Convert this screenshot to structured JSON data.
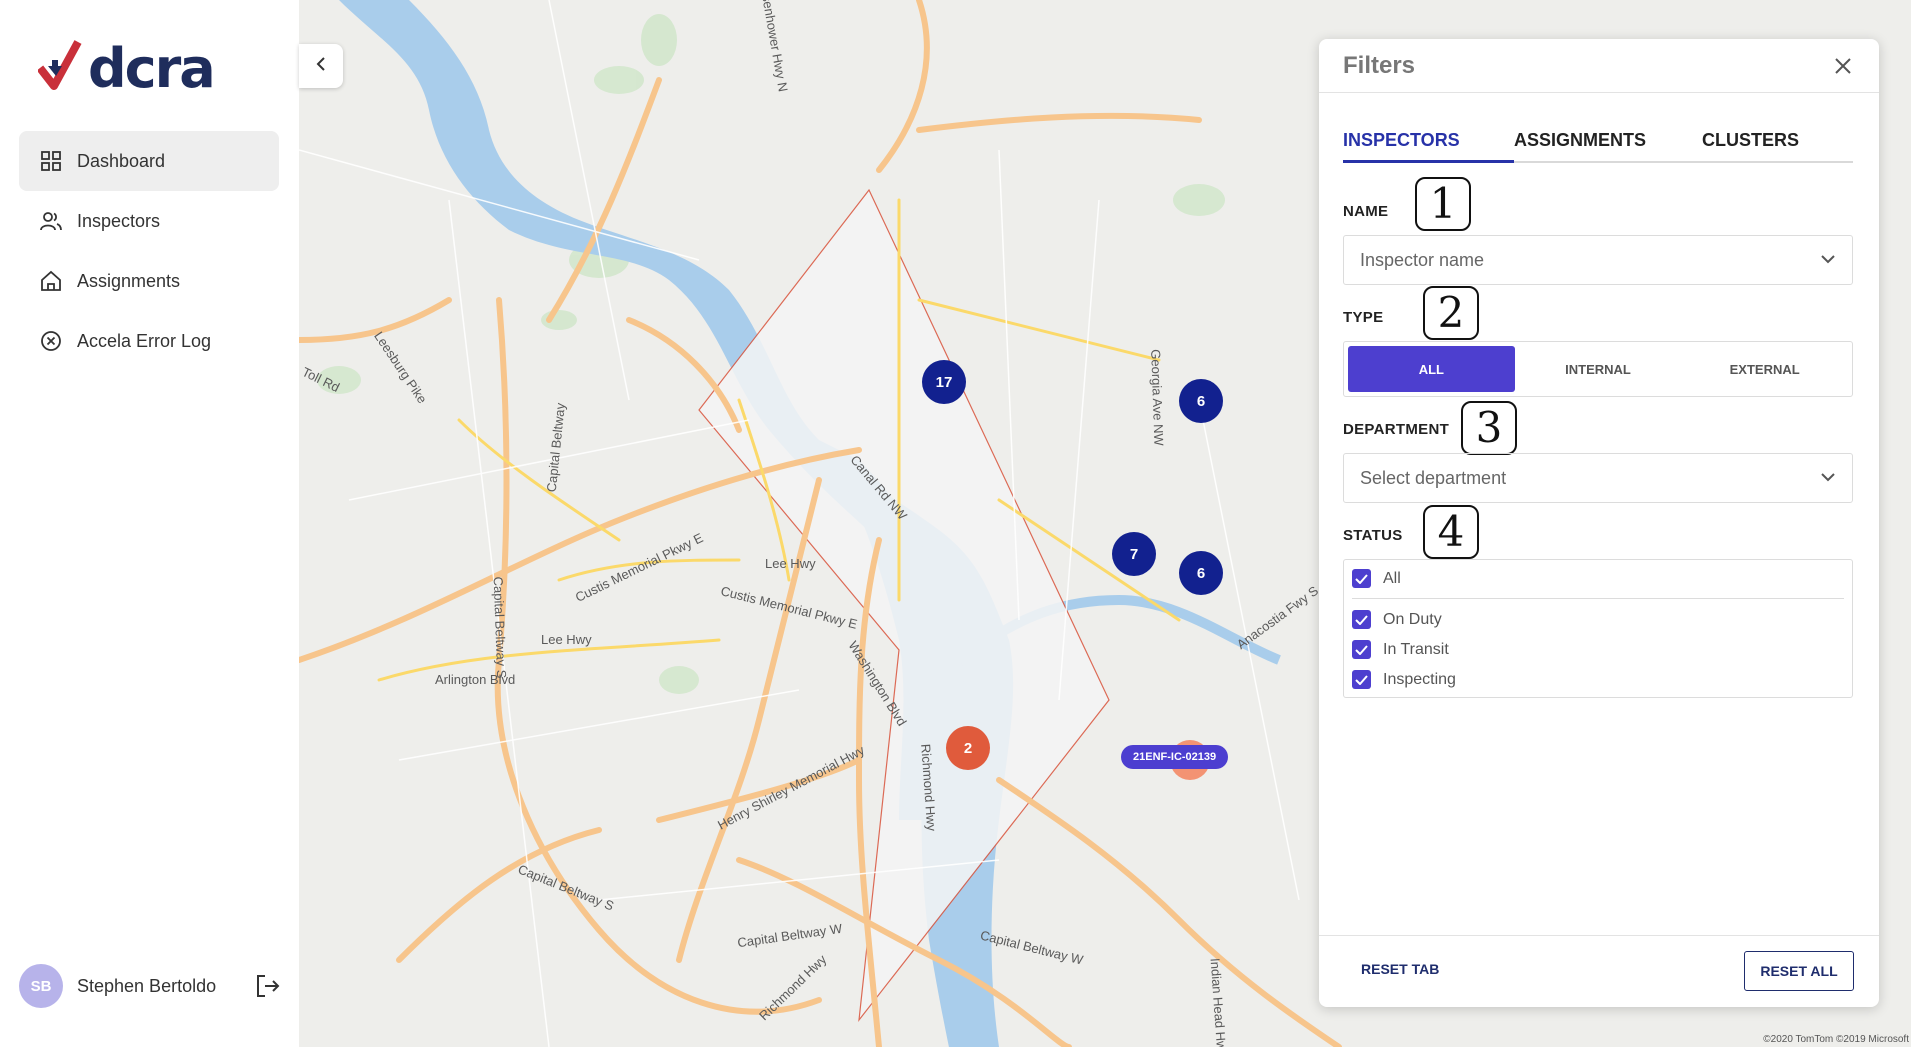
{
  "app": {
    "logo_text": "dcra"
  },
  "sidebar": {
    "items": [
      {
        "label": "Dashboard",
        "icon": "grid-icon",
        "active": true
      },
      {
        "label": "Inspectors",
        "icon": "users-icon",
        "active": false
      },
      {
        "label": "Assignments",
        "icon": "home-icon",
        "active": false
      },
      {
        "label": "Accela Error Log",
        "icon": "x-circle-icon",
        "active": false
      }
    ],
    "user": {
      "initials": "SB",
      "name": "Stephen Bertoldo"
    }
  },
  "map": {
    "clusters": [
      {
        "label": "17",
        "color": "#12218f"
      },
      {
        "label": "6",
        "color": "#12218f"
      },
      {
        "label": "7",
        "color": "#12218f"
      },
      {
        "label": "6",
        "color": "#12218f"
      },
      {
        "label": "2",
        "color": "#e05b3c"
      }
    ],
    "inspection_tag": "21ENF-IC-02139",
    "road_labels": [
      "Lee Hwy",
      "Lee Hwy",
      "Arlington Blvd",
      "Capital Beltway S",
      "Capital Beltway W",
      "Capital Beltway S",
      "Capital Beltway W",
      "Henry Shirley Memorial Hwy",
      "Washington Blvd",
      "Richmond Hwy",
      "Richmond Hwy",
      "Indian Head Hwy",
      "Georgia Ave NW",
      "Canal Rd NW",
      "Custis Memorial Pkwy E",
      "Custis Memorial Pkwy E",
      "Leesburg Pike",
      "Toll Rd",
      "Capital Beltway",
      "Anacostia Fwy S",
      "Eisenhower Hwy N"
    ],
    "copyright": "©2020 TomTom ©2019 Microsoft"
  },
  "filters": {
    "title": "Filters",
    "tabs": [
      "INSPECTORS",
      "ASSIGNMENTS",
      "CLUSTERS"
    ],
    "active_tab": "INSPECTORS",
    "name": {
      "label": "NAME",
      "placeholder": "Inspector name",
      "step": "1"
    },
    "type": {
      "label": "TYPE",
      "options": [
        "ALL",
        "INTERNAL",
        "EXTERNAL"
      ],
      "selected": "ALL",
      "step": "2"
    },
    "department": {
      "label": "DEPARTMENT",
      "placeholder": "Select department",
      "step": "3"
    },
    "status": {
      "label": "STATUS",
      "step": "4",
      "all": {
        "label": "All",
        "checked": true
      },
      "options": [
        {
          "label": "On Duty",
          "checked": true
        },
        {
          "label": "In Transit",
          "checked": true
        },
        {
          "label": "Inspecting",
          "checked": true
        }
      ]
    },
    "footer": {
      "reset_tab": "RESET TAB",
      "reset_all": "RESET ALL"
    },
    "accent_color": "#4d3fcf"
  }
}
